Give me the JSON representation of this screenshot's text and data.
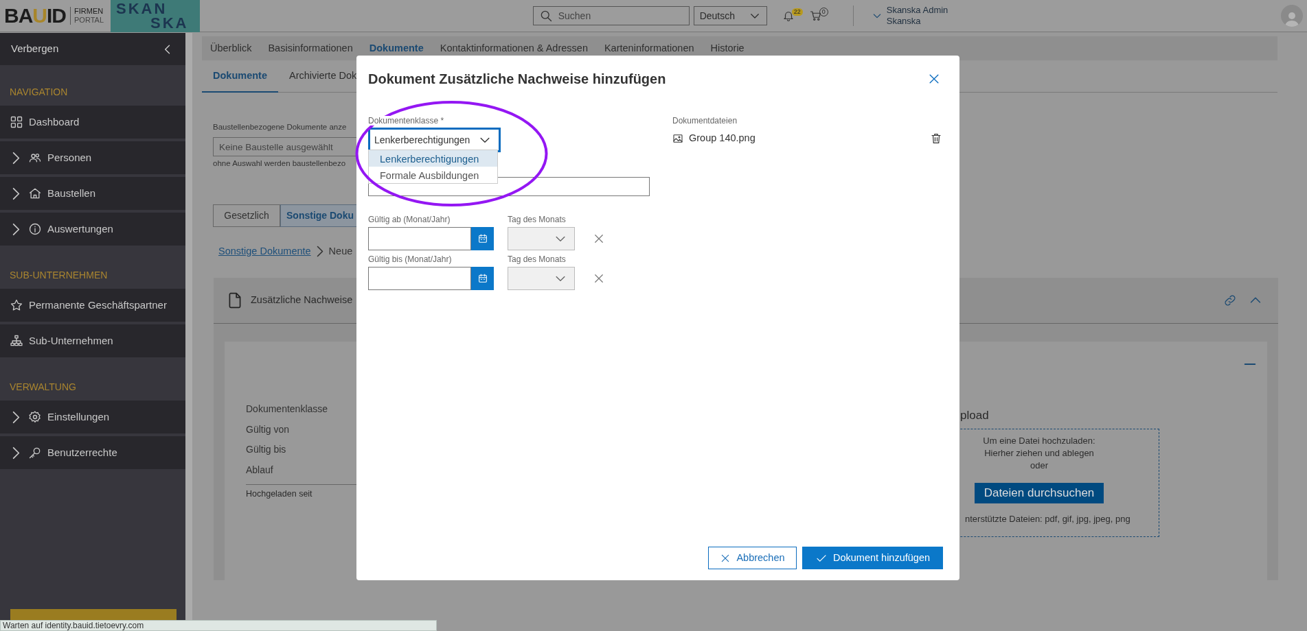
{
  "header": {
    "logo": [
      {
        "text": "BA",
        "accent": false
      },
      {
        "text": "U",
        "accent": true
      },
      {
        "text": "ID",
        "accent": false
      }
    ],
    "portal": [
      "FIRMEN",
      "PORTAL"
    ],
    "partner_logo": [
      "SKAN",
      "SKA"
    ],
    "search": {
      "placeholder": "Suchen"
    },
    "language": "Deutsch",
    "notifications": "22",
    "cart": "0",
    "user": {
      "name": "Skanska Admin",
      "company": "Skanska"
    }
  },
  "sidebar": {
    "toggle": "Verbergen",
    "sections": [
      {
        "title": "NAVIGATION",
        "items": [
          {
            "label": "Dashboard",
            "expandable": false
          },
          {
            "label": "Personen",
            "expandable": true
          },
          {
            "label": "Baustellen",
            "expandable": true
          },
          {
            "label": "Auswertungen",
            "expandable": true
          }
        ]
      },
      {
        "title": "SUB-UNTERNEHMEN",
        "items": [
          {
            "label": "Permanente Geschäftspartner",
            "expandable": false
          },
          {
            "label": "Sub-Unternehmen",
            "expandable": false
          }
        ]
      },
      {
        "title": "VERWALTUNG",
        "items": [
          {
            "label": "Einstellungen",
            "expandable": true
          },
          {
            "label": "Benutzerrechte",
            "expandable": true
          }
        ]
      }
    ]
  },
  "main": {
    "tabs": [
      {
        "label": "Überblick",
        "selected": false
      },
      {
        "label": "Basisinformationen",
        "selected": false
      },
      {
        "label": "Dokumente",
        "selected": true
      },
      {
        "label": "Kontaktinformationen & Adressen",
        "selected": false
      },
      {
        "label": "Karteninformationen",
        "selected": false
      },
      {
        "label": "Historie",
        "selected": false
      }
    ],
    "subtabs": [
      {
        "label": "Dokumente",
        "selected": true
      },
      {
        "label": "Archivierte Dok",
        "selected": false
      }
    ],
    "site_filter": {
      "label": "Baustellenbezogene Dokumente anze",
      "placeholder": "Keine Baustelle ausgewählt",
      "hint": "ohne Auswahl werden baustellenbezo"
    },
    "category_toggle": [
      {
        "label": "Gesetzlich",
        "selected": false
      },
      {
        "label": "Sonstige Doku",
        "selected": true
      }
    ],
    "breadcrumb": [
      "Sonstige Dokumente",
      "Neue"
    ],
    "section": {
      "title": "Zusätzliche Nachweise",
      "fields": [
        "Dokumentenklasse",
        "Gültig von",
        "Gültig bis",
        "Ablauf"
      ],
      "uploaded_label": "Hochgeladen seit",
      "upload": {
        "title": "pload",
        "lines": [
          "Um eine Datei hochzuladen:",
          "Hierher ziehen und ablegen",
          "oder"
        ],
        "button": "Dateien durchsuchen",
        "supported": "nterstützte Dateien: pdf, gif, jpg, jpeg, png"
      }
    }
  },
  "dialog": {
    "title": "Dokument Zusätzliche Nachweise hinzufügen",
    "class_field": {
      "label": "Dokumentenklasse *",
      "value": "Lenkerberechtigungen",
      "options": [
        {
          "label": "Lenkerberechtigungen",
          "selected": true
        },
        {
          "label": "Formale Ausbildungen",
          "selected": false
        }
      ]
    },
    "date_rows": [
      {
        "label": "Gültig ab (Monat/Jahr)",
        "day_label": "Tag des Monats"
      },
      {
        "label": "Gültig bis (Monat/Jahr)",
        "day_label": "Tag des Monats"
      }
    ],
    "files": {
      "label": "Dokumentdateien",
      "items": [
        "Group 140.png"
      ]
    },
    "buttons": {
      "cancel": "Abbrechen",
      "submit": "Dokument hinzufügen"
    }
  },
  "status_bar": "Warten auf identity.bauid.tietoevry.com"
}
